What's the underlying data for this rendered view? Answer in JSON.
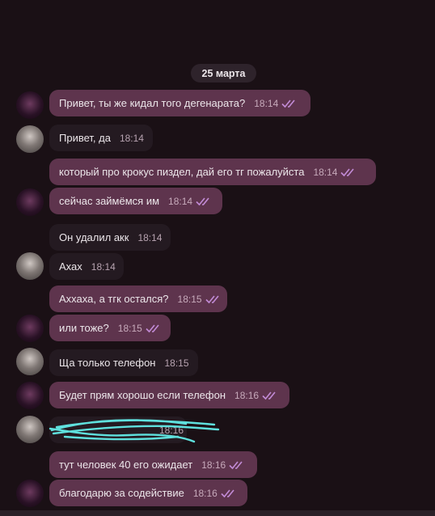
{
  "chat": {
    "date": "25 марта",
    "messages": [
      {
        "text": "Привет, ты же кидал того дегенарата?",
        "time": "18:14",
        "dir": "out"
      },
      {
        "text": "Привет, да",
        "time": "18:14",
        "dir": "in"
      },
      {
        "text": "который про крокус пиздел, дай его тг пожалуйста",
        "time": "18:14",
        "dir": "out"
      },
      {
        "text": "сейчас займёмся им",
        "time": "18:14",
        "dir": "out"
      },
      {
        "text": "Он удалил акк",
        "time": "18:14",
        "dir": "in"
      },
      {
        "text": "Ахах",
        "time": "18:14",
        "dir": "in"
      },
      {
        "text": "Аххаха, а тгк остался?",
        "time": "18:15",
        "dir": "out"
      },
      {
        "text": "или тоже?",
        "time": "18:15",
        "dir": "out"
      },
      {
        "text": "Ща только телефон",
        "time": "18:15",
        "dir": "in"
      },
      {
        "text": "Будет прям хорошо если телефон",
        "time": "18:16",
        "dir": "out"
      },
      {
        "text": "",
        "time": "18:16",
        "dir": "in"
      },
      {
        "text": "тут человек 40 его ожидает",
        "time": "18:16",
        "dir": "out"
      },
      {
        "text": "благодарю за содействие",
        "time": "18:16",
        "dir": "out"
      }
    ]
  },
  "colors": {
    "background": "#1a1015",
    "outgoing_bubble": "#5e344d",
    "incoming_bubble": "#241a21",
    "read_checks": "#c28bd6",
    "redaction": "#5fe0dd"
  },
  "icons": {
    "read_status": "double-check-icon",
    "own_avatar": "avatar-dark-icon",
    "contact_avatar": "avatar-photo-icon"
  }
}
